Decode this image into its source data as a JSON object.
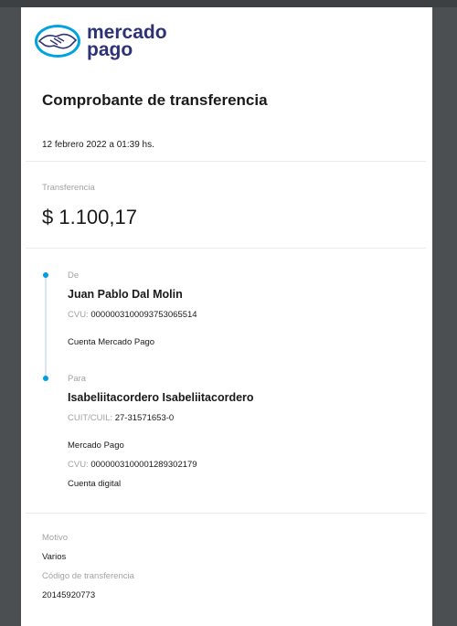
{
  "brand": {
    "line1": "mercado",
    "line2": "pago",
    "primary": "#2d3277",
    "accent": "#009ee3"
  },
  "title": "Comprobante de transferencia",
  "date": "12 febrero 2022 a 01:39 hs.",
  "transfer": {
    "label": "Transferencia",
    "amount": "$ 1.100,17"
  },
  "from": {
    "label": "De",
    "name": "Juan Pablo Dal Molin",
    "cvu_key": "CVU:",
    "cvu": "0000003100093753065514",
    "account": "Cuenta Mercado Pago"
  },
  "to": {
    "label": "Para",
    "name": "Isabeliitacordero Isabeliitacordero",
    "cuit_key": "CUIT/CUIL:",
    "cuit": "27-31571653-0",
    "bank": "Mercado Pago",
    "cvu_key": "CVU:",
    "cvu": "0000003100001289302179",
    "account": "Cuenta digital"
  },
  "details": {
    "motivo_label": "Motivo",
    "motivo": "Varios",
    "code_label": "Código de transferencia",
    "code": "20145920773"
  }
}
